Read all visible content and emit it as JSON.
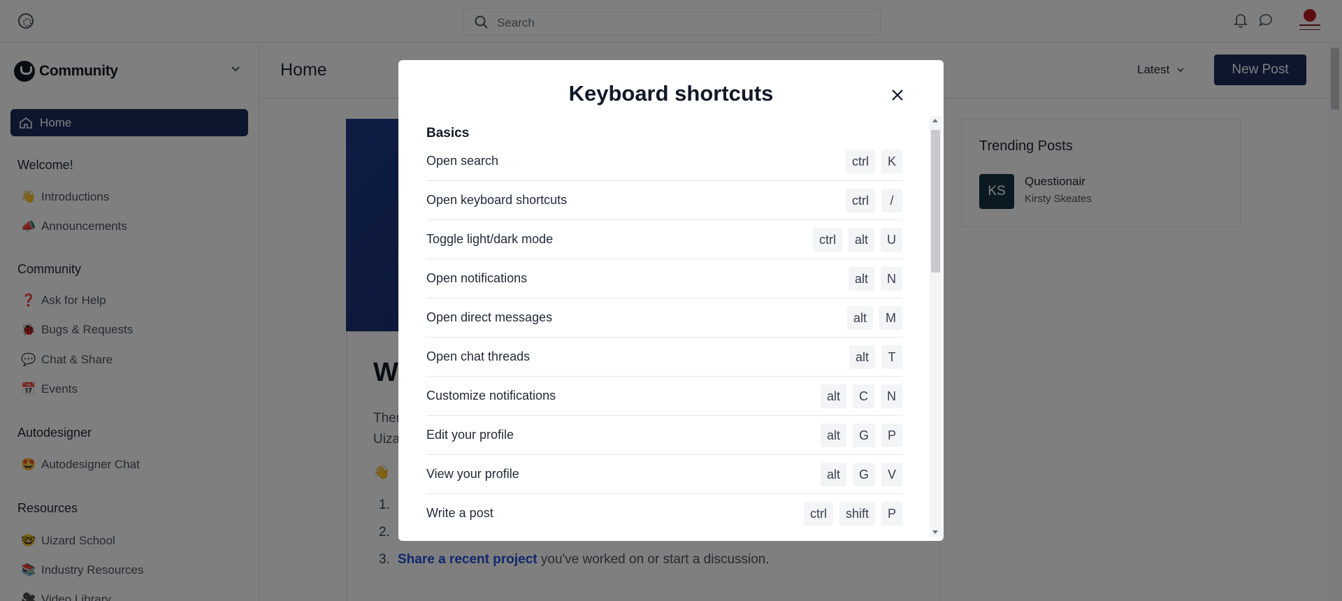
{
  "topbar": {
    "search_placeholder": "Search"
  },
  "sidebar": {
    "brand": "Community",
    "home_label": "Home",
    "groups": [
      {
        "label": "Welcome!",
        "items": [
          {
            "emoji": "👋",
            "label": "Introductions"
          },
          {
            "emoji": "📣",
            "label": "Announcements"
          }
        ]
      },
      {
        "label": "Community",
        "items": [
          {
            "emoji": "❓",
            "label": "Ask for Help"
          },
          {
            "emoji": "🐞",
            "label": "Bugs & Requests"
          },
          {
            "emoji": "💬",
            "label": "Chat & Share"
          },
          {
            "emoji": "📅",
            "label": "Events"
          }
        ]
      },
      {
        "label": "Autodesigner",
        "items": [
          {
            "emoji": "🤩",
            "label": "Autodesigner Chat"
          }
        ]
      },
      {
        "label": "Resources",
        "items": [
          {
            "emoji": "🤓",
            "label": "Uizard School"
          },
          {
            "emoji": "📚",
            "label": "Industry Resources"
          },
          {
            "emoji": "🎥",
            "label": "Video Library"
          }
        ]
      }
    ]
  },
  "main": {
    "title": "Home",
    "sort_label": "Latest",
    "new_post_label": "New Post",
    "feed": {
      "heading_fragment": "W",
      "line1_fragment": "Ther",
      "line2_fragment": "Uiza",
      "wave_emoji": "👋",
      "list_numbers": [
        "1.",
        "2.",
        "3."
      ],
      "item3_link": "Share a recent project",
      "item3_rest": " you've worked on or start a discussion."
    },
    "trending": {
      "title": "Trending Posts",
      "post": {
        "initials": "KS",
        "title": "Questionair",
        "author": "Kirsty Skeates"
      }
    }
  },
  "modal": {
    "title": "Keyboard shortcuts",
    "section": "Basics",
    "shortcuts": [
      {
        "label": "Open search",
        "keys": [
          "ctrl",
          "K"
        ]
      },
      {
        "label": "Open keyboard shortcuts",
        "keys": [
          "ctrl",
          "/"
        ]
      },
      {
        "label": "Toggle light/dark mode",
        "keys": [
          "ctrl",
          "alt",
          "U"
        ]
      },
      {
        "label": "Open notifications",
        "keys": [
          "alt",
          "N"
        ]
      },
      {
        "label": "Open direct messages",
        "keys": [
          "alt",
          "M"
        ]
      },
      {
        "label": "Open chat threads",
        "keys": [
          "alt",
          "T"
        ]
      },
      {
        "label": "Customize notifications",
        "keys": [
          "alt",
          "C",
          "N"
        ]
      },
      {
        "label": "Edit your profile",
        "keys": [
          "alt",
          "G",
          "P"
        ]
      },
      {
        "label": "View your profile",
        "keys": [
          "alt",
          "G",
          "V"
        ]
      },
      {
        "label": "Write a post",
        "keys": [
          "ctrl",
          "shift",
          "P"
        ]
      }
    ]
  }
}
